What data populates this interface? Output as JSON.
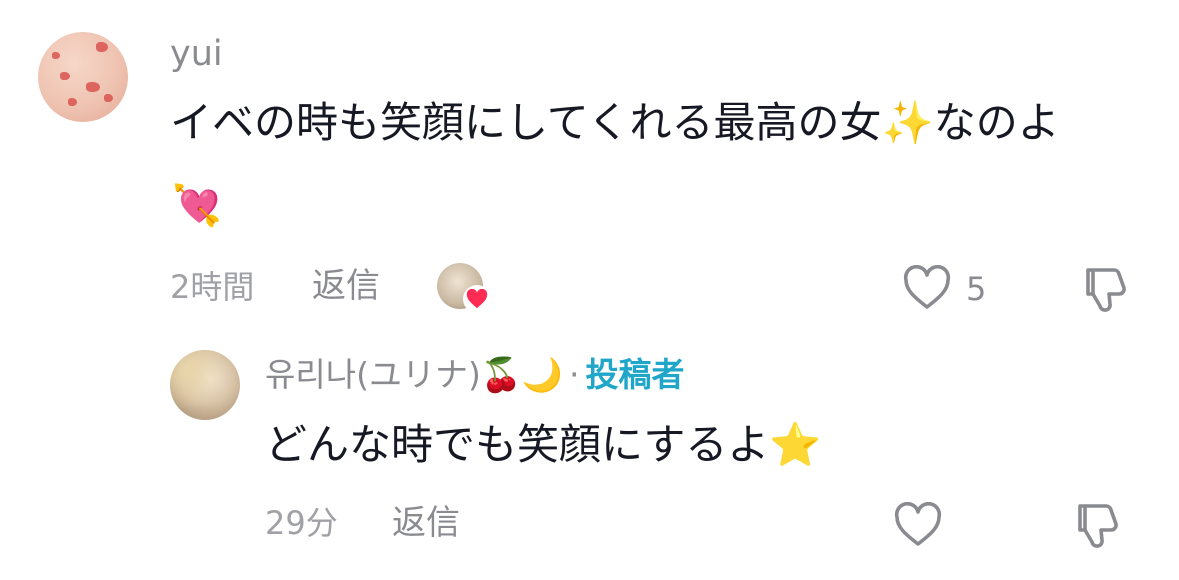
{
  "comment": {
    "username": "yui",
    "text": "イベの時も笑顔にしてくれる最高の女✨なのよ",
    "emoji_line": "💘",
    "time": "2時間",
    "reply_label": "返信",
    "like_count": "5",
    "liked_by_creator": true,
    "avatar_icon": "strawberry-ice-cream-avatar"
  },
  "reply": {
    "username": "유리나(ユリナ)🍒🌙",
    "separator": "·",
    "creator_label": "投稿者",
    "text": "どんな時でも笑顔にするよ⭐️",
    "time": "29分",
    "reply_label": "返信"
  },
  "colors": {
    "secondary_text": "#8a8b91",
    "primary_text": "#161823",
    "creator_accent": "#20a6c9",
    "heart_badge": "#fe2c55"
  }
}
